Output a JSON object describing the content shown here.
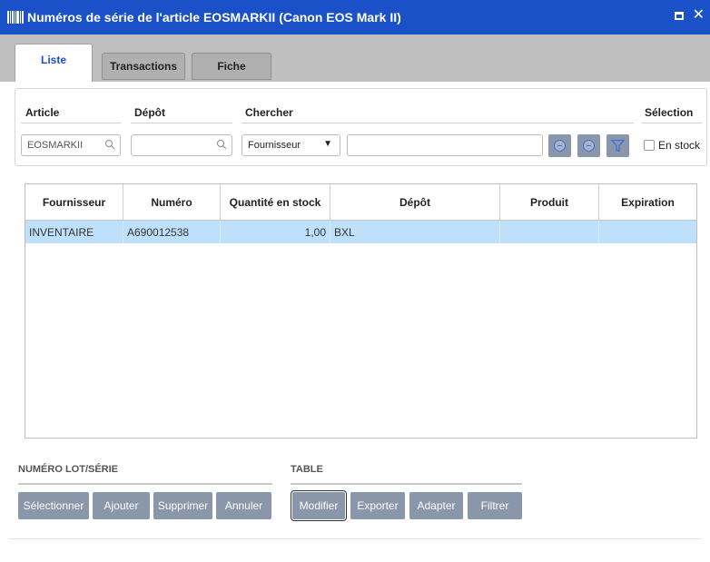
{
  "window": {
    "title": "Numéros de série de l'article EOSMARKII (Canon EOS Mark II)",
    "close_glyph": "✕"
  },
  "tabs": [
    {
      "label": "Liste",
      "active": true
    },
    {
      "label": "Transactions",
      "active": false
    },
    {
      "label": "Fiche",
      "active": false
    }
  ],
  "filters": {
    "article_label": "Article",
    "article_value": "EOSMARKII",
    "depot_label": "Dépôt",
    "depot_value": "",
    "chercher_label": "Chercher",
    "chercher_select": "Fournisseur",
    "chercher_value": "",
    "selection_label": "Sélection",
    "en_stock_label": "En stock",
    "en_stock_checked": false
  },
  "table": {
    "columns": [
      "Fournisseur",
      "Numéro",
      "Quantité en stock",
      "Dépôt",
      "Produit",
      "Expiration"
    ],
    "rows": [
      {
        "fournisseur": "INVENTAIRE",
        "numero": "A690012538",
        "quantite": "1,00",
        "depot": "BXL",
        "produit": "",
        "expiration": ""
      }
    ]
  },
  "sections": {
    "lot_title": "NUMÉRO LOT/SÉRIE",
    "lot_buttons": [
      "Sélectionner",
      "Ajouter",
      "Supprimer",
      "Annuler"
    ],
    "table_title": "TABLE",
    "table_buttons": [
      "Modifier",
      "Exporter",
      "Adapter",
      "Filtrer"
    ]
  },
  "colors": {
    "titlebar": "#1a50c8",
    "button": "#8a96aa",
    "selected_row": "#bfe0fb",
    "active_tab_text": "#1a50c8"
  },
  "icons": [
    "barcode-icon",
    "restore-icon",
    "close-icon",
    "search-icon",
    "dropdown-arrow-icon",
    "circle-minus-icon",
    "filter-funnel-icon"
  ]
}
